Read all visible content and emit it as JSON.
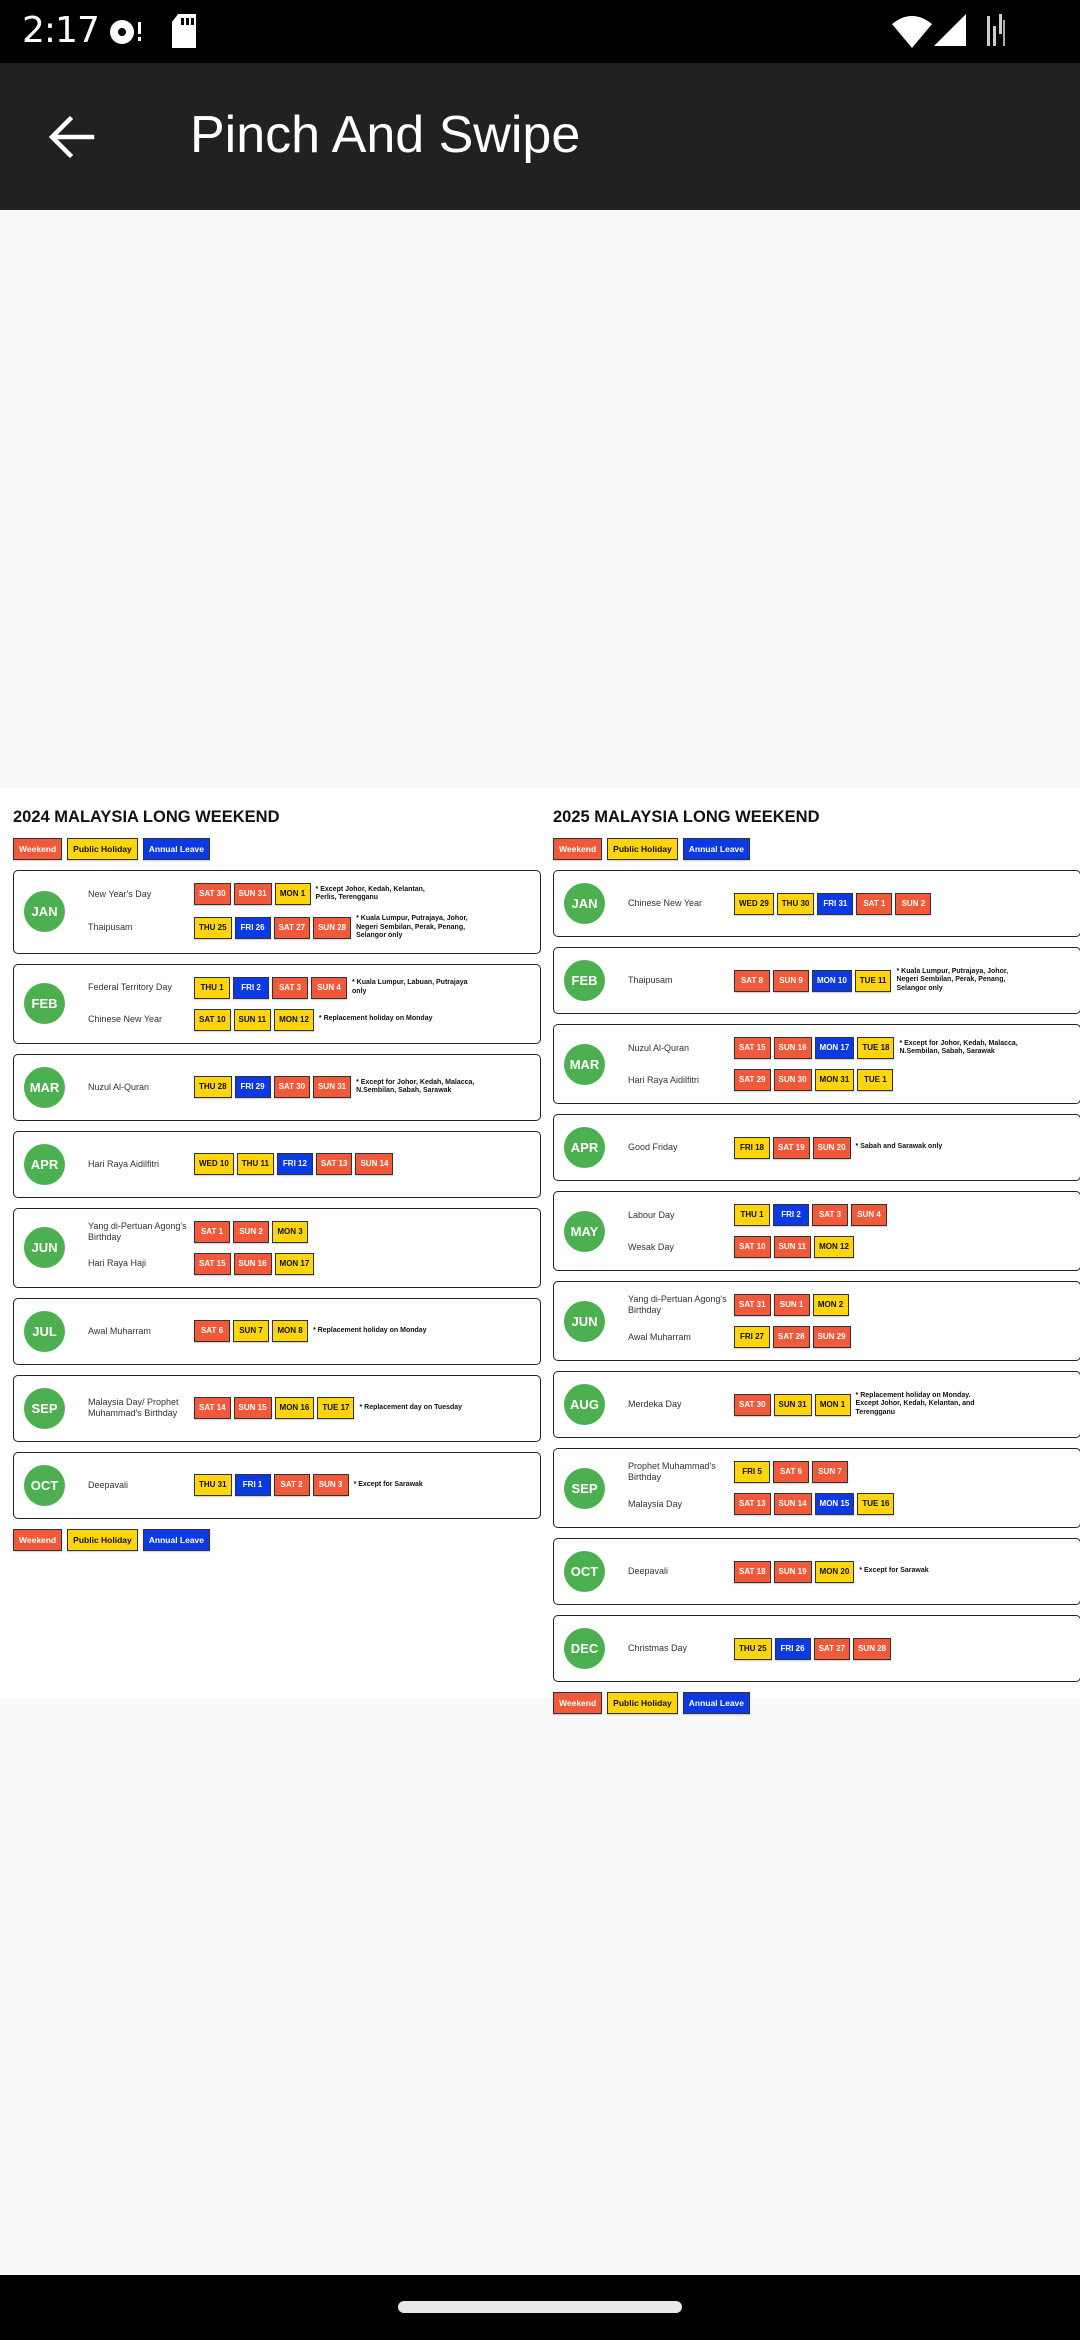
{
  "status_bar": {
    "time": "2:17",
    "left_icons": [
      "media-notification-icon",
      "sd-card-icon"
    ],
    "right_icons": [
      "wifi-icon",
      "cell-signal-icon",
      "battery-icon"
    ]
  },
  "app_bar": {
    "back_icon": "arrow-left-icon",
    "title": "Pinch And Swipe"
  },
  "legend": {
    "weekend": "Weekend",
    "public_holiday": "Public Holiday",
    "annual_leave": "Annual Leave"
  },
  "colors": {
    "weekend": "#f05a3a",
    "public_holiday": "#fed40d",
    "annual_leave": "#0b39e4",
    "month_badge": "#4caf50",
    "app_bar": "#212121"
  },
  "calendars": [
    {
      "title": "2024 MALAYSIA LONG WEEKEND",
      "months": [
        {
          "month": "JAN",
          "holidays": [
            {
              "name": "New Year's Day",
              "days": [
                {
                  "label": "SAT 30",
                  "type": "weekend"
                },
                {
                  "label": "SUN 31",
                  "type": "weekend"
                },
                {
                  "label": "MON 1",
                  "type": "holiday"
                }
              ],
              "note": "* Except Johor, Kedah, Kelantan, Perlis, Terengganu"
            },
            {
              "name": "Thaipusam",
              "days": [
                {
                  "label": "THU 25",
                  "type": "holiday"
                },
                {
                  "label": "FRI 26",
                  "type": "leave"
                },
                {
                  "label": "SAT 27",
                  "type": "weekend"
                },
                {
                  "label": "SUN 28",
                  "type": "weekend"
                }
              ],
              "note": "* Kuala Lumpur, Putrajaya, Johor, Negeri Sembilan, Perak, Penang, Selangor only"
            }
          ]
        },
        {
          "month": "FEB",
          "holidays": [
            {
              "name": "Federal Territory Day",
              "days": [
                {
                  "label": "THU 1",
                  "type": "holiday"
                },
                {
                  "label": "FRI 2",
                  "type": "leave"
                },
                {
                  "label": "SAT 3",
                  "type": "weekend"
                },
                {
                  "label": "SUN 4",
                  "type": "weekend"
                }
              ],
              "note": "* Kuala Lumpur, Labuan, Putrajaya only"
            },
            {
              "name": "Chinese New Year",
              "days": [
                {
                  "label": "SAT 10",
                  "type": "holiday"
                },
                {
                  "label": "SUN 11",
                  "type": "holiday"
                },
                {
                  "label": "MON 12",
                  "type": "holiday"
                }
              ],
              "note": "* Replacement holiday on Monday"
            }
          ]
        },
        {
          "month": "MAR",
          "holidays": [
            {
              "name": "Nuzul Al-Quran",
              "days": [
                {
                  "label": "THU 28",
                  "type": "holiday"
                },
                {
                  "label": "FRI 29",
                  "type": "leave"
                },
                {
                  "label": "SAT 30",
                  "type": "weekend"
                },
                {
                  "label": "SUN 31",
                  "type": "weekend"
                }
              ],
              "note": "* Except for Johor, Kedah, Malacca, N.Sembilan, Sabah, Sarawak"
            }
          ]
        },
        {
          "month": "APR",
          "holidays": [
            {
              "name": "Hari Raya Aidilfitri",
              "days": [
                {
                  "label": "WED 10",
                  "type": "holiday"
                },
                {
                  "label": "THU 11",
                  "type": "holiday"
                },
                {
                  "label": "FRI 12",
                  "type": "leave"
                },
                {
                  "label": "SAT 13",
                  "type": "weekend"
                },
                {
                  "label": "SUN 14",
                  "type": "weekend"
                }
              ],
              "note": ""
            }
          ]
        },
        {
          "month": "JUN",
          "holidays": [
            {
              "name": "Yang di-Pertuan Agong's Birthday",
              "days": [
                {
                  "label": "SAT 1",
                  "type": "weekend"
                },
                {
                  "label": "SUN 2",
                  "type": "weekend"
                },
                {
                  "label": "MON 3",
                  "type": "holiday"
                }
              ],
              "note": ""
            },
            {
              "name": "Hari Raya Haji",
              "days": [
                {
                  "label": "SAT 15",
                  "type": "weekend"
                },
                {
                  "label": "SUN 16",
                  "type": "weekend"
                },
                {
                  "label": "MON 17",
                  "type": "holiday"
                }
              ],
              "note": ""
            }
          ]
        },
        {
          "month": "JUL",
          "holidays": [
            {
              "name": "Awal Muharram",
              "days": [
                {
                  "label": "SAT 6",
                  "type": "weekend"
                },
                {
                  "label": "SUN 7",
                  "type": "holiday"
                },
                {
                  "label": "MON 8",
                  "type": "holiday"
                }
              ],
              "note": "* Replacement holiday on Monday"
            }
          ]
        },
        {
          "month": "SEP",
          "holidays": [
            {
              "name": "Malaysia Day/ Prophet Muhammad's Birthday",
              "days": [
                {
                  "label": "SAT 14",
                  "type": "weekend"
                },
                {
                  "label": "SUN 15",
                  "type": "weekend"
                },
                {
                  "label": "MON 16",
                  "type": "holiday"
                },
                {
                  "label": "TUE 17",
                  "type": "holiday"
                }
              ],
              "note": "* Replacement day on Tuesday"
            }
          ]
        },
        {
          "month": "OCT",
          "holidays": [
            {
              "name": "Deepavali",
              "days": [
                {
                  "label": "THU 31",
                  "type": "holiday"
                },
                {
                  "label": "FRI 1",
                  "type": "leave"
                },
                {
                  "label": "SAT 2",
                  "type": "weekend"
                },
                {
                  "label": "SUN 3",
                  "type": "weekend"
                }
              ],
              "note": "* Except for Sarawak"
            }
          ]
        }
      ],
      "bottom_legend": true
    },
    {
      "title": "2025 MALAYSIA LONG WEEKEND",
      "months": [
        {
          "month": "JAN",
          "holidays": [
            {
              "name": "Chinese New Year",
              "days": [
                {
                  "label": "WED 29",
                  "type": "holiday"
                },
                {
                  "label": "THU 30",
                  "type": "holiday"
                },
                {
                  "label": "FRI 31",
                  "type": "leave"
                },
                {
                  "label": "SAT 1",
                  "type": "weekend"
                },
                {
                  "label": "SUN 2",
                  "type": "weekend"
                }
              ],
              "note": ""
            }
          ]
        },
        {
          "month": "FEB",
          "holidays": [
            {
              "name": "Thaipusam",
              "days": [
                {
                  "label": "SAT 8",
                  "type": "weekend"
                },
                {
                  "label": "SUN 9",
                  "type": "weekend"
                },
                {
                  "label": "MON 10",
                  "type": "leave"
                },
                {
                  "label": "TUE 11",
                  "type": "holiday"
                }
              ],
              "note": "* Kuala Lumpur, Putrajaya, Johor, Negeri Sembilan, Perak, Penang, Selangor only"
            }
          ]
        },
        {
          "month": "MAR",
          "holidays": [
            {
              "name": "Nuzul Al-Quran",
              "days": [
                {
                  "label": "SAT 15",
                  "type": "weekend"
                },
                {
                  "label": "SUN 16",
                  "type": "weekend"
                },
                {
                  "label": "MON 17",
                  "type": "leave"
                },
                {
                  "label": "TUE 18",
                  "type": "holiday"
                }
              ],
              "note": "* Except for Johor, Kedah, Malacca, N.Sembilan, Sabah, Sarawak"
            },
            {
              "name": "Hari Raya Aidilfitri",
              "days": [
                {
                  "label": "SAT 29",
                  "type": "weekend"
                },
                {
                  "label": "SUN 30",
                  "type": "weekend"
                },
                {
                  "label": "MON 31",
                  "type": "holiday"
                },
                {
                  "label": "TUE 1",
                  "type": "holiday"
                }
              ],
              "note": ""
            }
          ]
        },
        {
          "month": "APR",
          "holidays": [
            {
              "name": "Good Friday",
              "days": [
                {
                  "label": "FRI 18",
                  "type": "holiday"
                },
                {
                  "label": "SAT 19",
                  "type": "weekend"
                },
                {
                  "label": "SUN 20",
                  "type": "weekend"
                }
              ],
              "note": "* Sabah and Sarawak only"
            }
          ]
        },
        {
          "month": "MAY",
          "holidays": [
            {
              "name": "Labour Day",
              "days": [
                {
                  "label": "THU 1",
                  "type": "holiday"
                },
                {
                  "label": "FRI 2",
                  "type": "leave"
                },
                {
                  "label": "SAT 3",
                  "type": "weekend"
                },
                {
                  "label": "SUN 4",
                  "type": "weekend"
                }
              ],
              "note": ""
            },
            {
              "name": "Wesak Day",
              "days": [
                {
                  "label": "SAT 10",
                  "type": "weekend"
                },
                {
                  "label": "SUN 11",
                  "type": "weekend"
                },
                {
                  "label": "MON 12",
                  "type": "holiday"
                }
              ],
              "note": ""
            }
          ]
        },
        {
          "month": "JUN",
          "holidays": [
            {
              "name": "Yang di-Pertuan Agong's Birthday",
              "days": [
                {
                  "label": "SAT 31",
                  "type": "weekend"
                },
                {
                  "label": "SUN 1",
                  "type": "weekend"
                },
                {
                  "label": "MON 2",
                  "type": "holiday"
                }
              ],
              "note": ""
            },
            {
              "name": "Awal Muharram",
              "days": [
                {
                  "label": "FRI 27",
                  "type": "holiday"
                },
                {
                  "label": "SAT 28",
                  "type": "weekend"
                },
                {
                  "label": "SUN 29",
                  "type": "weekend"
                }
              ],
              "note": ""
            }
          ]
        },
        {
          "month": "AUG",
          "holidays": [
            {
              "name": "Merdeka Day",
              "days": [
                {
                  "label": "SAT 30",
                  "type": "weekend"
                },
                {
                  "label": "SUN 31",
                  "type": "holiday"
                },
                {
                  "label": "MON 1",
                  "type": "holiday"
                }
              ],
              "note": "* Replacement holiday on Monday. Except Johor, Kedah, Kelantan, and Terengganu"
            }
          ]
        },
        {
          "month": "SEP",
          "holidays": [
            {
              "name": "Prophet Muhammad's Birthday",
              "days": [
                {
                  "label": "FRI 5",
                  "type": "holiday"
                },
                {
                  "label": "SAT 6",
                  "type": "weekend"
                },
                {
                  "label": "SUN 7",
                  "type": "weekend"
                }
              ],
              "note": ""
            },
            {
              "name": "Malaysia Day",
              "days": [
                {
                  "label": "SAT 13",
                  "type": "weekend"
                },
                {
                  "label": "SUN 14",
                  "type": "weekend"
                },
                {
                  "label": "MON 15",
                  "type": "leave"
                },
                {
                  "label": "TUE 16",
                  "type": "holiday"
                }
              ],
              "note": ""
            }
          ]
        },
        {
          "month": "OCT",
          "holidays": [
            {
              "name": "Deepavali",
              "days": [
                {
                  "label": "SAT 18",
                  "type": "weekend"
                },
                {
                  "label": "SUN 19",
                  "type": "weekend"
                },
                {
                  "label": "MON 20",
                  "type": "holiday"
                }
              ],
              "note": "* Except for Sarawak"
            }
          ]
        },
        {
          "month": "DEC",
          "holidays": [
            {
              "name": "Christmas Day",
              "days": [
                {
                  "label": "THU 25",
                  "type": "holiday"
                },
                {
                  "label": "FRI 26",
                  "type": "leave"
                },
                {
                  "label": "SAT 27",
                  "type": "weekend"
                },
                {
                  "label": "SUN 28",
                  "type": "weekend"
                }
              ],
              "note": ""
            }
          ]
        }
      ],
      "bottom_legend": true
    }
  ]
}
